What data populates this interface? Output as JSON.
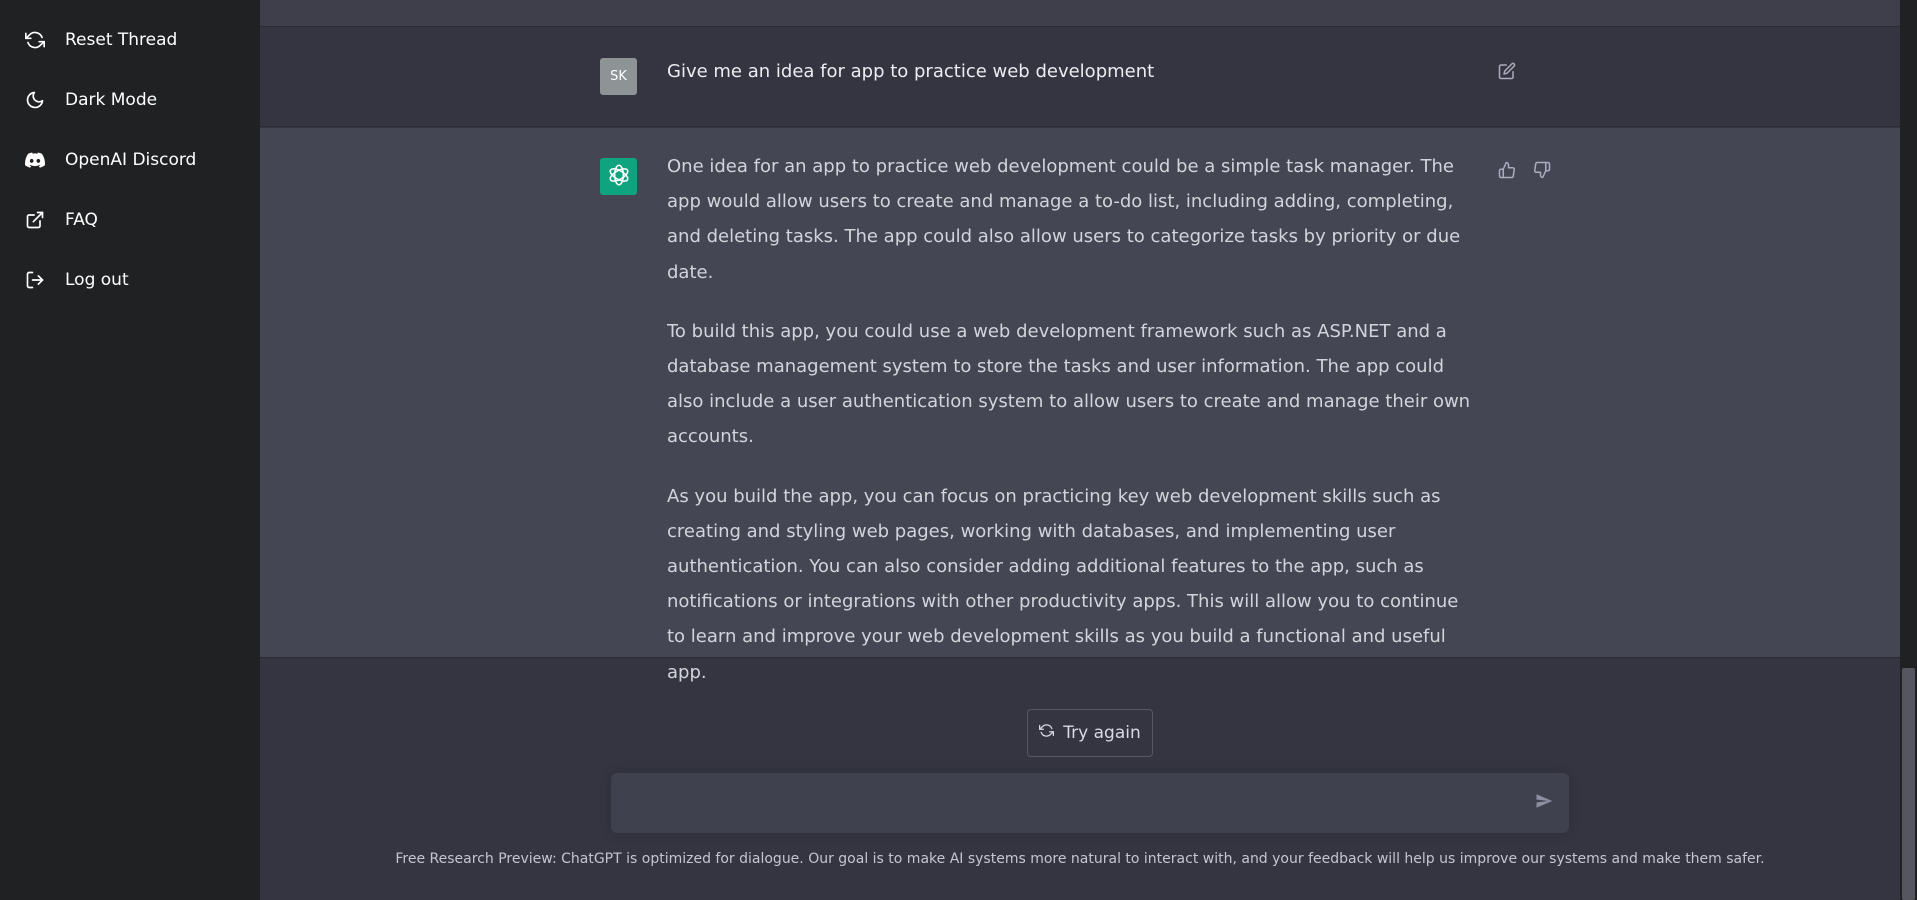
{
  "sidebar": {
    "items": [
      {
        "label": "Reset Thread",
        "icon": "refresh-icon"
      },
      {
        "label": "Dark Mode",
        "icon": "moon-icon"
      },
      {
        "label": "OpenAI Discord",
        "icon": "discord-icon"
      },
      {
        "label": "FAQ",
        "icon": "external-link-icon"
      },
      {
        "label": "Log out",
        "icon": "logout-icon"
      }
    ]
  },
  "conversation": {
    "user": {
      "avatar_initials": "SK",
      "message": "Give me an idea for app to practice web development"
    },
    "assistant": {
      "paragraphs": [
        "One idea for an app to practice web development could be a simple task manager. The app would allow users to create and manage a to-do list, including adding, completing, and deleting tasks. The app could also allow users to categorize tasks by priority or due date.",
        "To build this app, you could use a web development framework such as ASP.NET and a database management system to store the tasks and user information. The app could also include a user authentication system to allow users to create and manage their own accounts.",
        "As you build the app, you can focus on practicing key web development skills such as creating and styling web pages, working with databases, and implementing user authentication. You can also consider adding additional features to the app, such as notifications or integrations with other productivity apps. This will allow you to continue to learn and improve your web development skills as you build a functional and useful app."
      ]
    }
  },
  "actions": {
    "try_again_label": "Try again"
  },
  "composer": {
    "value": "",
    "placeholder": ""
  },
  "footer": {
    "note": "Free Research Preview: ChatGPT is optimized for dialogue. Our goal is to make AI systems more natural to interact with, and your feedback will help us improve our systems and make them safer."
  },
  "colors": {
    "sidebar_bg": "#202123",
    "main_bg": "#343541",
    "assistant_bg": "#444654",
    "brand": "#10a37f"
  }
}
